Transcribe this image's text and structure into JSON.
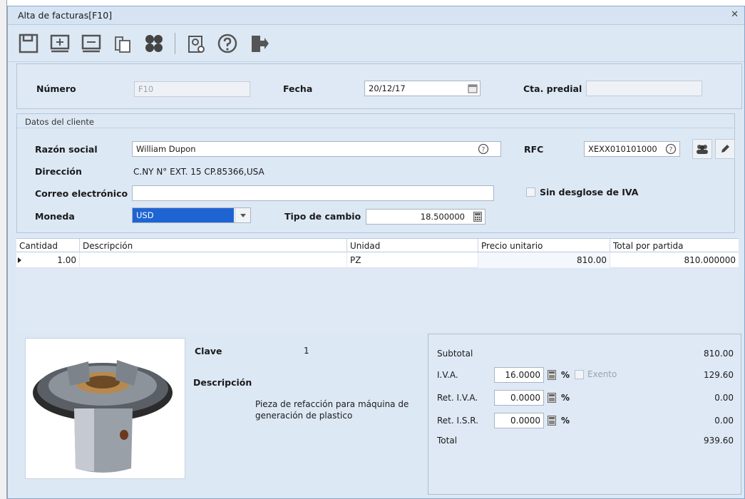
{
  "window": {
    "title": "Alta de facturas[F10]",
    "close_glyph": "✕"
  },
  "toolbar": {
    "buttons": [
      "save-icon",
      "add-detail-icon",
      "remove-detail-icon",
      "copy-icon",
      "modules-icon",
      "tax-settings-icon",
      "help-icon",
      "exit-icon"
    ]
  },
  "header": {
    "numero_label": "Número",
    "numero_value": "F10",
    "fecha_label": "Fecha",
    "fecha_value": "20/12/17",
    "cta_label": "Cta. predial",
    "cta_value": ""
  },
  "cliente": {
    "group_title": "Datos del cliente",
    "razon_label": "Razón social",
    "razon_value": "William Dupon",
    "rfc_label": "RFC",
    "rfc_value": "XEXX010101000",
    "direccion_label": "Dirección",
    "direccion_value": "C.NY N° EXT. 15 CP.85366,USA",
    "correo_label": "Correo electrónico",
    "correo_value": "",
    "sin_desglose_label": "Sin desglose de IVA",
    "moneda_label": "Moneda",
    "moneda_value": "USD",
    "tipo_cambio_label": "Tipo de cambio",
    "tipo_cambio_value": "18.500000"
  },
  "grid": {
    "columns": [
      "Cantidad",
      "Descripción",
      "Unidad",
      "Precio unitario",
      "Total por partida"
    ],
    "rows": [
      {
        "cantidad": "1.00",
        "descripcion": "",
        "unidad": "PZ",
        "precio": "810.00",
        "total": "810.000000"
      }
    ]
  },
  "product": {
    "clave_label": "Clave",
    "clave_value": "1",
    "descripcion_label": "Descripción",
    "descripcion_line1": "Pieza de refacción para máquina de",
    "descripcion_line2": "generación de plastico"
  },
  "totals": {
    "subtotal_label": "Subtotal",
    "subtotal_value": "810.00",
    "iva_label": "I.V.A.",
    "iva_rate": "16.0000",
    "iva_value": "129.60",
    "exento_label": "Exento",
    "ret_iva_label": "Ret. I.V.A.",
    "ret_iva_rate": "0.0000",
    "ret_iva_value": "0.00",
    "ret_isr_label": "Ret. I.S.R.",
    "ret_isr_rate": "0.0000",
    "ret_isr_value": "0.00",
    "total_label": "Total",
    "total_value": "939.60",
    "pct_symbol": "%"
  },
  "colors": {
    "panel": "#dfe9f6",
    "selection": "#1e64d2",
    "border": "#a8b5c6"
  }
}
